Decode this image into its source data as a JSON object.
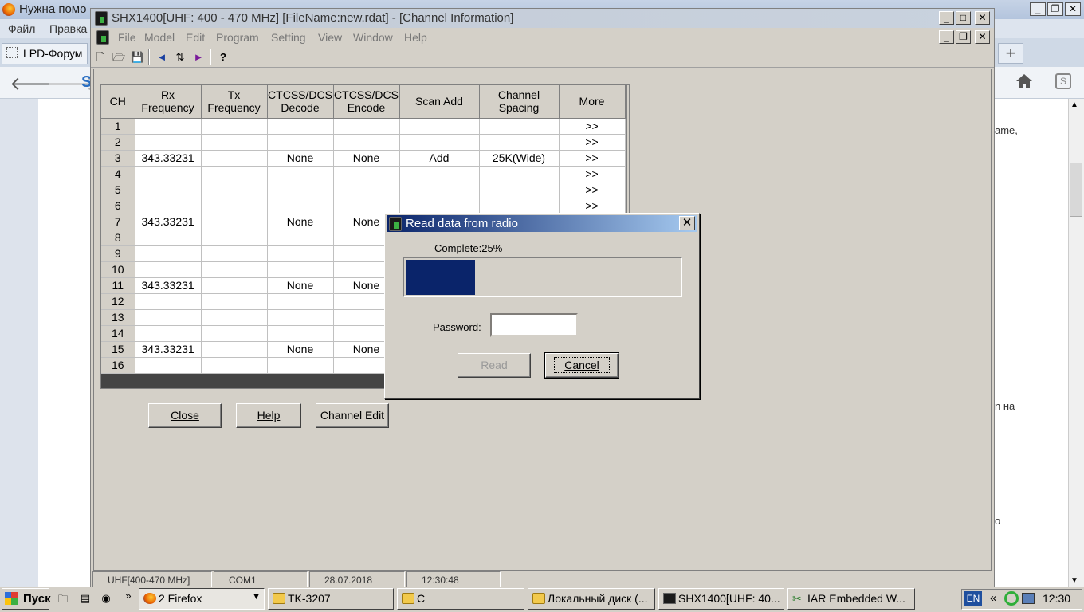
{
  "browser": {
    "title": "Нужна помо",
    "menu": [
      "Файл",
      "Правка"
    ],
    "tab_label": "LPD-Форум",
    "new_tab": "+",
    "logo_letter": "S",
    "page_fragments": [
      "ame,",
      "n на",
      "o"
    ]
  },
  "app": {
    "title": "SHX1400[UHF: 400 - 470 MHz] [FileName:new.rdat] - [Channel Information]",
    "window_buttons": {
      "minimize": "_",
      "maximize": "□",
      "close": "✕"
    },
    "doc_buttons": {
      "minimize": "_",
      "restore": "❐",
      "close": "✕"
    },
    "menu": [
      "File",
      "Model",
      "Edit",
      "Program",
      "Setting",
      "View",
      "Window",
      "Help"
    ],
    "toolbar_icons": [
      "new-file-icon",
      "open-folder-icon",
      "save-icon",
      "read-from-radio-icon",
      "write-to-radio-icon",
      "send-icon",
      "help-icon"
    ],
    "status": [
      "UHF[400-470 MHz]",
      "COM1",
      "28.07.2018",
      "12:30:48"
    ]
  },
  "grid": {
    "columns": [
      {
        "l1": "CH",
        "l2": ""
      },
      {
        "l1": "Rx",
        "l2": "Frequency"
      },
      {
        "l1": "Tx",
        "l2": "Frequency"
      },
      {
        "l1": "CTCSS/DCS",
        "l2": "Decode"
      },
      {
        "l1": "CTCSS/DCS",
        "l2": "Encode"
      },
      {
        "l1": "Scan Add",
        "l2": ""
      },
      {
        "l1": "Channel",
        "l2": "Spacing"
      },
      {
        "l1": "More",
        "l2": ""
      }
    ],
    "rows": [
      {
        "ch": "1",
        "rx": "",
        "tx": "",
        "dec": "",
        "enc": "",
        "scan": "",
        "spacing": "",
        "more": ">>"
      },
      {
        "ch": "2",
        "rx": "",
        "tx": "",
        "dec": "",
        "enc": "",
        "scan": "",
        "spacing": "",
        "more": ">>"
      },
      {
        "ch": "3",
        "rx": "343.33231",
        "tx": "",
        "dec": "None",
        "enc": "None",
        "scan": "Add",
        "spacing": "25K(Wide)",
        "more": ">>"
      },
      {
        "ch": "4",
        "rx": "",
        "tx": "",
        "dec": "",
        "enc": "",
        "scan": "",
        "spacing": "",
        "more": ">>"
      },
      {
        "ch": "5",
        "rx": "",
        "tx": "",
        "dec": "",
        "enc": "",
        "scan": "",
        "spacing": "",
        "more": ">>"
      },
      {
        "ch": "6",
        "rx": "",
        "tx": "",
        "dec": "",
        "enc": "",
        "scan": "",
        "spacing": "",
        "more": ">>"
      },
      {
        "ch": "7",
        "rx": "343.33231",
        "tx": "",
        "dec": "None",
        "enc": "None",
        "scan": "",
        "spacing": "",
        "more": ""
      },
      {
        "ch": "8",
        "rx": "",
        "tx": "",
        "dec": "",
        "enc": "",
        "scan": "",
        "spacing": "",
        "more": ""
      },
      {
        "ch": "9",
        "rx": "",
        "tx": "",
        "dec": "",
        "enc": "",
        "scan": "",
        "spacing": "",
        "more": ""
      },
      {
        "ch": "10",
        "rx": "",
        "tx": "",
        "dec": "",
        "enc": "",
        "scan": "",
        "spacing": "",
        "more": ""
      },
      {
        "ch": "11",
        "rx": "343.33231",
        "tx": "",
        "dec": "None",
        "enc": "None",
        "scan": "",
        "spacing": "",
        "more": ""
      },
      {
        "ch": "12",
        "rx": "",
        "tx": "",
        "dec": "",
        "enc": "",
        "scan": "",
        "spacing": "",
        "more": ""
      },
      {
        "ch": "13",
        "rx": "",
        "tx": "",
        "dec": "",
        "enc": "",
        "scan": "",
        "spacing": "",
        "more": ""
      },
      {
        "ch": "14",
        "rx": "",
        "tx": "",
        "dec": "",
        "enc": "",
        "scan": "",
        "spacing": "",
        "more": ""
      },
      {
        "ch": "15",
        "rx": "343.33231",
        "tx": "",
        "dec": "None",
        "enc": "None",
        "scan": "",
        "spacing": "",
        "more": ""
      },
      {
        "ch": "16",
        "rx": "",
        "tx": "",
        "dec": "",
        "enc": "",
        "scan": "",
        "spacing": "",
        "more": ""
      }
    ]
  },
  "buttons": {
    "close": "Close",
    "help": "Help",
    "channel_edit": "Channel Edit"
  },
  "dialog": {
    "title": "Read data from radio",
    "complete_label": "Complete:25%",
    "progress": 0.25,
    "password_label": "Password:",
    "password_value": "",
    "read": "Read",
    "cancel": "Cancel",
    "close": "✕"
  },
  "taskbar": {
    "start": "Пуск",
    "more": "»",
    "tasks": [
      {
        "label": "2 Firefox",
        "icon": "firefox-icon"
      },
      {
        "label": "TK-3207",
        "icon": "folder-icon"
      },
      {
        "label": "C",
        "icon": "folder-icon"
      },
      {
        "label": "Локальный диск (...",
        "icon": "folder-icon"
      },
      {
        "label": "SHX1400[UHF: 40...",
        "icon": "app-icon"
      },
      {
        "label": "IAR Embedded W...",
        "icon": "iar-icon"
      }
    ],
    "lang": "EN",
    "tray_expand": "«",
    "clock": "12:30"
  },
  "colors": {
    "dialog_title": "#0a246a",
    "progress_fill": "#0a246a",
    "window_face": "#d4d0c8"
  }
}
